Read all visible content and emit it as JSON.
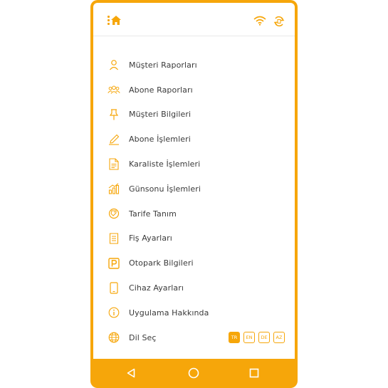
{
  "header": {
    "home_icon": "home-icon",
    "status_icons": [
      "wifi-icon",
      "sync-icon"
    ]
  },
  "menu": {
    "items": [
      {
        "label": "Müşteri Raporları",
        "icon": "user-icon"
      },
      {
        "label": "Abone Raporları",
        "icon": "group-icon"
      },
      {
        "label": "Müşteri Bilgileri",
        "icon": "pin-icon"
      },
      {
        "label": "Abone İşlemleri",
        "icon": "edit-icon"
      },
      {
        "label": "Karaliste İşlemleri",
        "icon": "document-icon"
      },
      {
        "label": "Günsonu İşlemleri",
        "icon": "chart-icon"
      },
      {
        "label": "Tarife Tanım",
        "icon": "tag-icon"
      },
      {
        "label": "Fiş Ayarları",
        "icon": "receipt-icon"
      },
      {
        "label": "Otopark Bilgileri",
        "icon": "parking-icon"
      },
      {
        "label": "Cihaz Ayarları",
        "icon": "phone-icon"
      },
      {
        "label": "Uygulama Hakkında",
        "icon": "info-icon"
      },
      {
        "label": "Dil Seç",
        "icon": "globe-icon"
      }
    ],
    "languages": [
      "TR",
      "EN",
      "DE",
      "AZ"
    ],
    "selected_language": "TR"
  },
  "colors": {
    "accent": "#f6a60a",
    "text": "#3a3a3a",
    "background": "#ffffff"
  },
  "navbar": [
    "back-icon",
    "home-circle-icon",
    "recents-icon"
  ]
}
